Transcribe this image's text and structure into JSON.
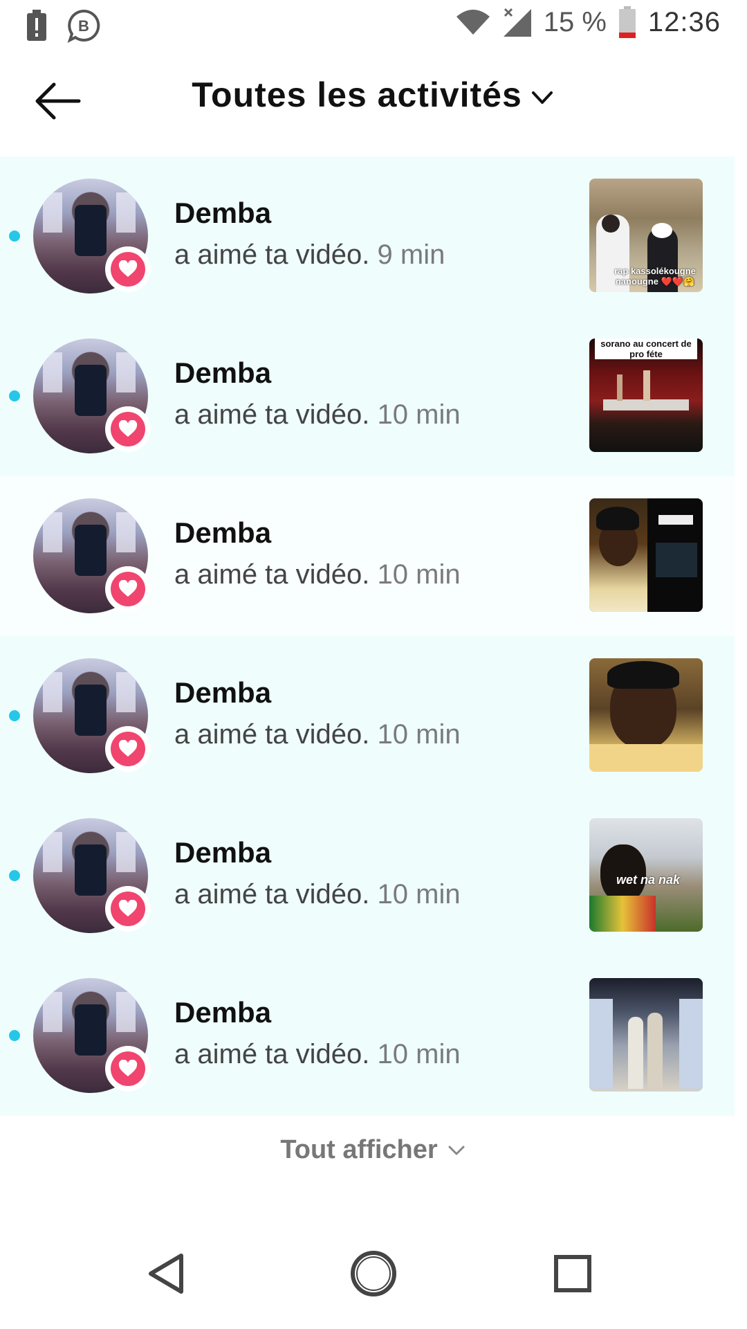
{
  "status_bar": {
    "icons_left": [
      "battery-alert-icon",
      "business-b-icon"
    ],
    "icons_right": [
      "wifi-icon",
      "cellular-no-signal-icon",
      "battery-low-icon"
    ],
    "battery": "15 %",
    "time": "12:36"
  },
  "header": {
    "back_icon": "arrow-left-icon",
    "title": "Toutes les activités",
    "title_chevron": "chevron-down-icon"
  },
  "activities": [
    {
      "user": "Demba",
      "text": "a aimé ta vidéo.",
      "time": "9 min",
      "unread": true,
      "badge": "heart-icon",
      "thumb_caption": "rap kassolékougne nanougne ❤️❤️🤗"
    },
    {
      "user": "Demba",
      "text": "a aimé ta vidéo.",
      "time": "10 min",
      "unread": true,
      "badge": "heart-icon",
      "thumb_caption": "sorano au concert de pro féte"
    },
    {
      "user": "Demba",
      "text": "a aimé ta vidéo.",
      "time": "10 min",
      "unread": false,
      "badge": "heart-icon",
      "thumb_caption": ""
    },
    {
      "user": "Demba",
      "text": "a aimé ta vidéo.",
      "time": "10 min",
      "unread": true,
      "badge": "heart-icon",
      "thumb_caption": ""
    },
    {
      "user": "Demba",
      "text": "a aimé ta vidéo.",
      "time": "10 min",
      "unread": true,
      "badge": "heart-icon",
      "thumb_caption": "wet na nak"
    },
    {
      "user": "Demba",
      "text": "a aimé ta vidéo.",
      "time": "10 min",
      "unread": true,
      "badge": "heart-icon",
      "thumb_caption": ""
    }
  ],
  "footer": {
    "see_all_label": "Tout afficher",
    "see_all_icon": "chevron-down-icon"
  },
  "nav_bar": {
    "buttons": [
      "back-triangle-icon",
      "home-circle-icon",
      "recents-square-icon"
    ]
  },
  "colors": {
    "unread_bg": "#effdfd",
    "unread_dot": "#25c7e8",
    "like_badge": "#f0456e"
  }
}
